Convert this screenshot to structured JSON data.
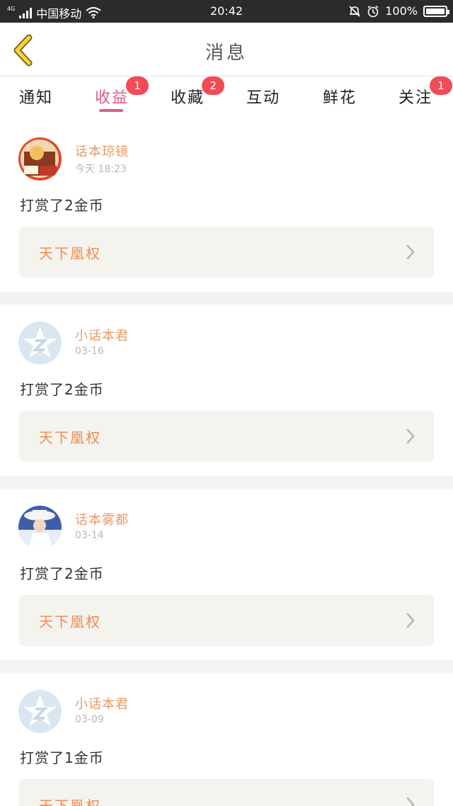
{
  "status_bar": {
    "network": "4G",
    "carrier": "中国移动",
    "time": "20:42",
    "battery": "100%"
  },
  "header": {
    "title": "消息"
  },
  "tabs": [
    {
      "label": "通知",
      "badge": ""
    },
    {
      "label": "收益",
      "badge": "1"
    },
    {
      "label": "收藏",
      "badge": "2"
    },
    {
      "label": "互动",
      "badge": ""
    },
    {
      "label": "鲜花",
      "badge": ""
    },
    {
      "label": "关注",
      "badge": "1"
    }
  ],
  "messages": [
    {
      "user": "话本琼镜",
      "time": "今天 18:23",
      "text": "打赏了2金币",
      "book": "天下凰权"
    },
    {
      "user": "小话本君",
      "time": "03-16",
      "text": "打赏了2金币",
      "book": "天下凰权"
    },
    {
      "user": "话本雾都",
      "time": "03-14",
      "text": "打赏了2金币",
      "book": "天下凰权"
    },
    {
      "user": "小话本君",
      "time": "03-09",
      "text": "打赏了1金币",
      "book": "天下凰权"
    }
  ],
  "colors": {
    "accent_pink": "#e05b8c",
    "badge_red": "#f24b55",
    "username_orange": "#e89a63",
    "book_orange": "#ee8e52"
  }
}
